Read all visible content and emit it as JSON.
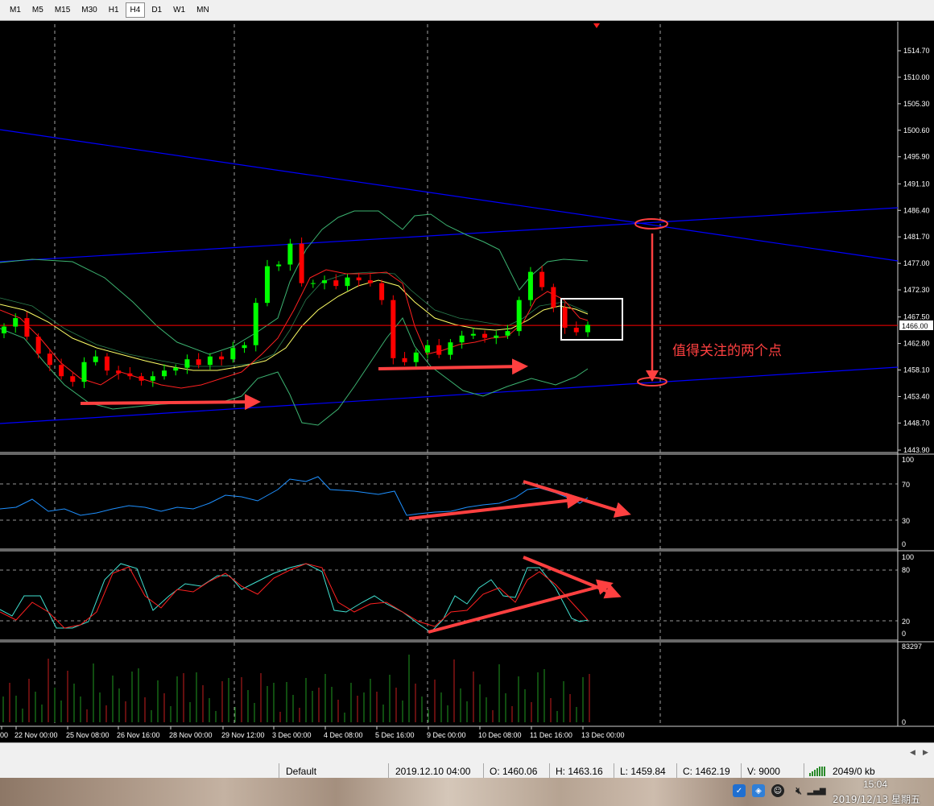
{
  "toolbar": {
    "timeframes": [
      "M1",
      "M5",
      "M15",
      "M30",
      "H1",
      "H4",
      "D1",
      "W1",
      "MN"
    ],
    "active": "H4"
  },
  "chart": {
    "price_ticks": [
      "1514.70",
      "1510.00",
      "1505.30",
      "1500.60",
      "1495.90",
      "1491.10",
      "1486.40",
      "1481.70",
      "1477.00",
      "1472.30",
      "1467.50",
      "1462.80",
      "1458.10",
      "1453.40",
      "1448.70",
      "1443.90"
    ],
    "current_price": "1466.00",
    "time_labels": [
      "00",
      "22 Nov 00:00",
      "25 Nov 08:00",
      "26 Nov 16:00",
      "28 Nov 00:00",
      "29 Nov 12:00",
      "3 Dec 00:00",
      "4 Dec 08:00",
      "5 Dec 16:00",
      "9 Dec 00:00",
      "10 Dec 08:00",
      "11 Dec 16:00",
      "13 Dec 00:00"
    ],
    "annotation": "值得关注的两个点",
    "rsi_levels": [
      "100",
      "70",
      "30",
      "0"
    ],
    "stoch_levels": [
      "100",
      "80",
      "20",
      "0"
    ],
    "volume_max": "83297",
    "volume_min": "0",
    "colors": {
      "bull_candle": "#00ff00",
      "bear_candle": "#ff0000",
      "trendline": "#0000ff",
      "bollinger": "#3cb371",
      "ma_fast": "#ff0000",
      "ma_slow": "#ffff66",
      "rsi": "#1e90ff",
      "stoch_main": "#40e0d0",
      "stoch_signal": "#ff2020",
      "grid": "#c8c8c8",
      "annotation": "#ff4040",
      "price_line": "#ff0000"
    }
  },
  "chart_data": {
    "type": "candlestick",
    "symbol_timeframe": "H4",
    "price_range": [
      1443.9,
      1514.7
    ],
    "current_price": 1466.0,
    "approx_close_path": [
      1465.8,
      1467.3,
      1464.0,
      1461.0,
      1459.0,
      1457.0,
      1456.0,
      1459.5,
      1460.5,
      1458.0,
      1457.5,
      1457.0,
      1456.2,
      1457.0,
      1458.0,
      1458.5,
      1460.0,
      1459.0,
      1460.5,
      1460.0,
      1462.0,
      1462.5,
      1470.0,
      1476.5,
      1476.8,
      1480.5,
      1473.5,
      1473.5,
      1474.0,
      1473.0,
      1474.5,
      1474.0,
      1473.5,
      1470.5,
      1460.2,
      1459.5,
      1461.2,
      1462.5,
      1460.8,
      1463.0,
      1464.2,
      1464.5,
      1463.8,
      1464.2,
      1465.0,
      1470.5,
      1475.5,
      1472.8,
      1469.2,
      1465.6,
      1464.8,
      1466.1
    ],
    "rsi_range": [
      0,
      100
    ],
    "stochastic_range": [
      0,
      100
    ],
    "volume_range": [
      0,
      83297
    ]
  },
  "status": {
    "profile": "Default",
    "datetime": "2019.12.10 04:00",
    "open": "O: 1460.06",
    "high": "H: 1463.16",
    "low": "L: 1459.84",
    "close": "C: 1462.19",
    "volume": "V: 9000",
    "connection": "2049/0 kb"
  },
  "taskbar": {
    "time": "15:04",
    "date": "2019/12/13 星期五"
  }
}
